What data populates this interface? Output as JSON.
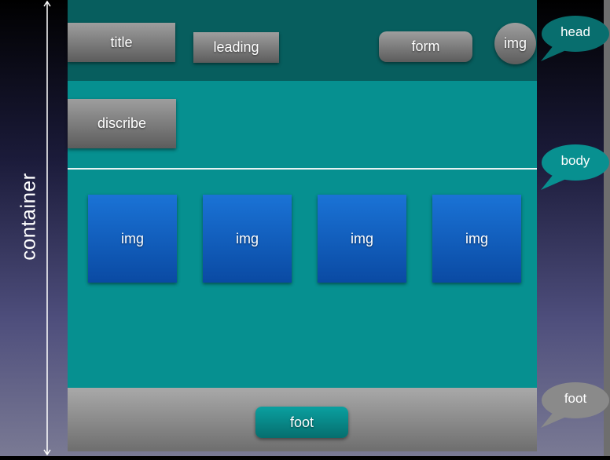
{
  "container": {
    "label": "container"
  },
  "head": {
    "title": "title",
    "leading": "leading",
    "form": "form",
    "img": "img"
  },
  "body": {
    "describe": "discribe",
    "images": [
      "img",
      "img",
      "img",
      "img"
    ]
  },
  "foot": {
    "button": "foot"
  },
  "callouts": {
    "head": "head",
    "body": "body",
    "foot": "foot"
  },
  "colors": {
    "head_panel": "#075e5e",
    "body_panel": "#069090",
    "image_tile": "#0a56b5",
    "callout_teal": "#086e6e",
    "callout_grey": "#8a8a8a"
  }
}
